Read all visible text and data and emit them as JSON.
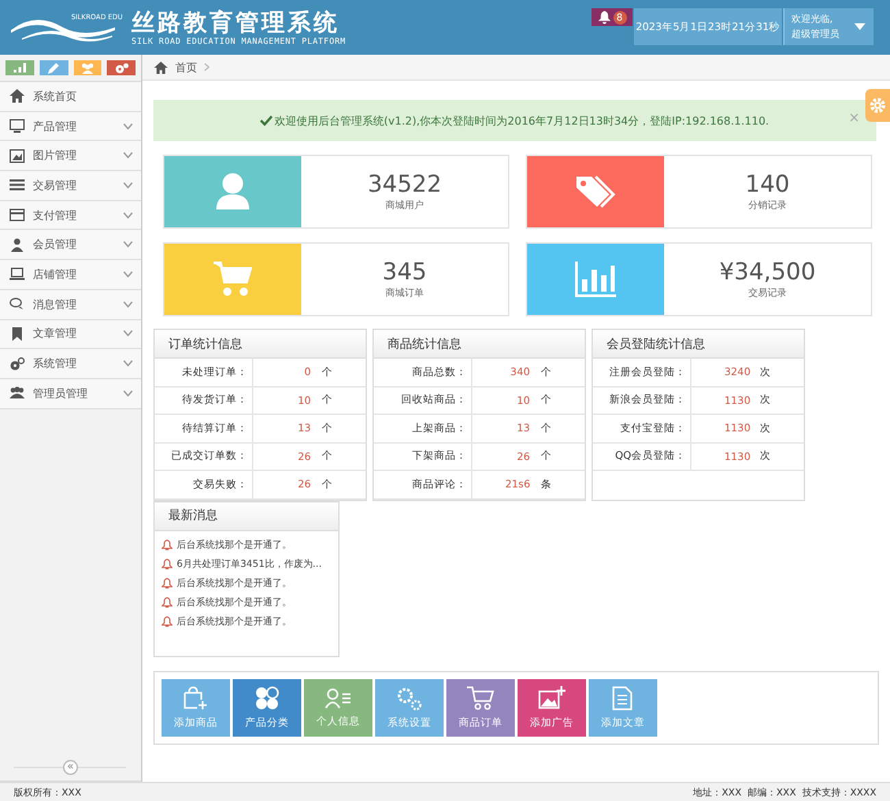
{
  "header": {
    "brand": "SILKROAD EDU",
    "title": "丝路教育管理系统",
    "subtitle": "SILK ROAD EDUCATION MANAGEMENT PLATFORM",
    "notification_count": "8",
    "datetime": "2023年5月1日23时21分31秒",
    "welcome": "欢迎光临,",
    "role": "超级管理员"
  },
  "sidebar": {
    "shortcuts": [
      {
        "color": "#87b87f"
      },
      {
        "color": "#6fb3e0"
      },
      {
        "color": "#ffb752"
      },
      {
        "color": "#d15b47"
      }
    ],
    "items": [
      {
        "label": "系统首页",
        "expandable": false,
        "selected": false
      },
      {
        "label": "产品管理",
        "expandable": true,
        "selected": false
      },
      {
        "label": "图片管理",
        "expandable": true,
        "selected": false
      },
      {
        "label": "交易管理",
        "expandable": true,
        "selected": false
      },
      {
        "label": "支付管理",
        "expandable": true,
        "selected": false
      },
      {
        "label": "会员管理",
        "expandable": true,
        "selected": false
      },
      {
        "label": "店铺管理",
        "expandable": true,
        "selected": false
      },
      {
        "label": "消息管理",
        "expandable": true,
        "selected": false
      },
      {
        "label": "文章管理",
        "expandable": true,
        "selected": false
      },
      {
        "label": "系统管理",
        "expandable": true,
        "selected": false
      },
      {
        "label": "管理员管理",
        "expandable": true,
        "selected": false
      }
    ],
    "collapse_toggle": "«"
  },
  "breadcrumb": [
    "首页"
  ],
  "alert": {
    "text": "欢迎使用后台管理系统(v1.2),你本次登陆时间为2016年7月12日13时34分，登陆IP:192.168.1.110.",
    "close": "×"
  },
  "stats": [
    {
      "value": "34522",
      "label": "商城用户",
      "color": "#68c7c9"
    },
    {
      "value": "140",
      "label": "分销记录",
      "color": "#fc6a5e"
    },
    {
      "value": "345",
      "label": "商城订单",
      "color": "#f9cf3f"
    },
    {
      "value": "¥34,500",
      "label": "交易记录",
      "color": "#54c4f0"
    }
  ],
  "tables": [
    {
      "title": "订单统计信息",
      "rows": [
        {
          "label": "未处理订单：",
          "value": "0",
          "unit": "个"
        },
        {
          "label": "待发货订单：",
          "value": "10",
          "unit": "个"
        },
        {
          "label": "待结算订单：",
          "value": "13",
          "unit": "个"
        },
        {
          "label": "已成交订单数：",
          "value": "26",
          "unit": "个"
        },
        {
          "label": "交易失败：",
          "value": "26",
          "unit": "个"
        }
      ]
    },
    {
      "title": "商品统计信息",
      "rows": [
        {
          "label": "商品总数：",
          "value": "340",
          "unit": "个"
        },
        {
          "label": "回收站商品：",
          "value": "10",
          "unit": "个"
        },
        {
          "label": "上架商品：",
          "value": "13",
          "unit": "个"
        },
        {
          "label": "下架商品：",
          "value": "26",
          "unit": "个"
        },
        {
          "label": "商品评论：",
          "value": "21s6",
          "unit": "条"
        }
      ]
    },
    {
      "title": "会员登陆统计信息",
      "rows": [
        {
          "label": "注册会员登陆：",
          "value": "3240",
          "unit": "次"
        },
        {
          "label": "新浪会员登陆：",
          "value": "1130",
          "unit": "次"
        },
        {
          "label": "支付宝登陆：",
          "value": "1130",
          "unit": "次"
        },
        {
          "label": "QQ会员登陆：",
          "value": "1130",
          "unit": "次"
        }
      ]
    }
  ],
  "news": {
    "title": "最新消息",
    "items": [
      "后台系统找那个是开通了。",
      "6月共处理订单3451比，作废为...",
      "后台系统找那个是开通了。",
      "后台系统找那个是开通了。",
      "后台系统找那个是开通了。"
    ]
  },
  "shortcuts": [
    {
      "label": "添加商品",
      "color": "#6fb3e0"
    },
    {
      "label": "产品分类",
      "color": "#428bca"
    },
    {
      "label": "个人信息",
      "color": "#87b87f"
    },
    {
      "label": "系统设置",
      "color": "#6fb3e0"
    },
    {
      "label": "商品订单",
      "color": "#9585bf"
    },
    {
      "label": "添加广告",
      "color": "#d6487e"
    },
    {
      "label": "添加文章",
      "color": "#6fb3e0"
    }
  ],
  "footer": {
    "left": "版权所有：XXX",
    "right": "地址：XXX  邮编：XXX  技术支持：XXXX"
  }
}
